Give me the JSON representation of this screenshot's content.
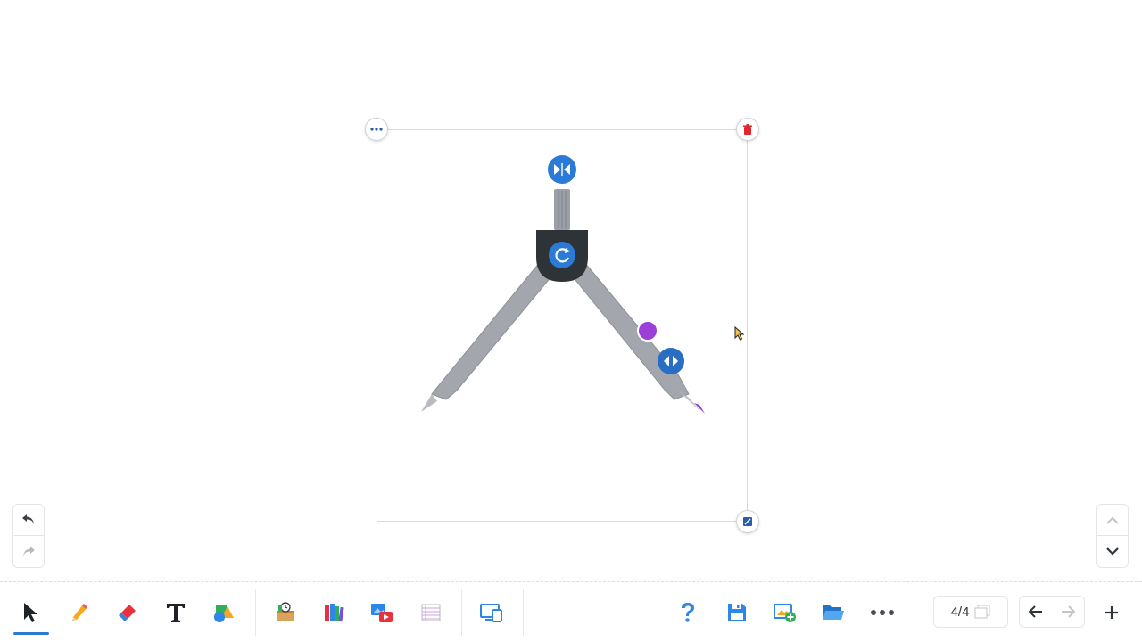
{
  "page": {
    "indicator": "4/4"
  },
  "colors": {
    "accent": "#2a7ad6",
    "compass_arm": "#a3a7ad",
    "compass_head": "#2e3338",
    "pencil_lead": "#8a3fd1",
    "delete_red": "#e0262f"
  },
  "canvas": {
    "selected_object": "compass-tool",
    "handles": [
      "more-icon",
      "trash-icon",
      "resize-icon"
    ],
    "compass_controls": [
      "flip-icon",
      "rotate-icon",
      "adjust-width-icon",
      "draw-point-handle"
    ]
  },
  "side_controls": {
    "left": [
      "undo-icon",
      "redo-icon"
    ],
    "right": [
      "chevron-up-icon",
      "chevron-down-icon"
    ]
  },
  "toolbar": {
    "tools": [
      "select-icon",
      "pencil-icon",
      "eraser-icon",
      "text-icon",
      "shapes-icon"
    ],
    "resources": [
      "toolbox-icon",
      "library-icon",
      "media-icon",
      "lined-paper-icon"
    ],
    "devices": [
      "device-icon"
    ],
    "actions": [
      "help-icon",
      "save-icon",
      "add-slide-icon",
      "folder-icon",
      "more-icon"
    ],
    "navigation": [
      "arrow-left-icon",
      "arrow-right-icon",
      "plus-icon"
    ]
  }
}
